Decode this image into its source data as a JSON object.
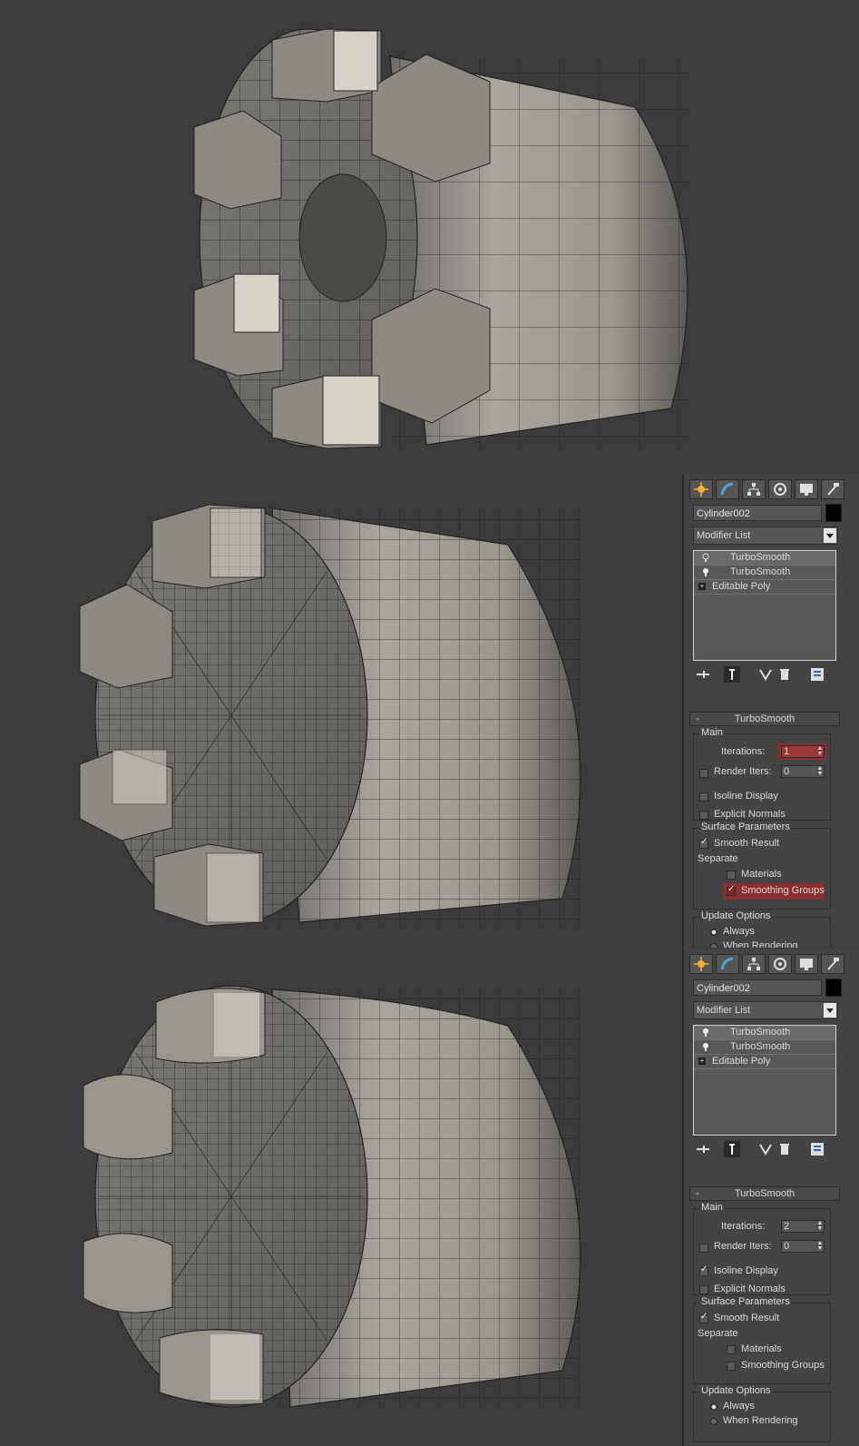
{
  "colors": {
    "viewport_bg": "#3c3c3c",
    "panel_bg": "#444444",
    "mesh_face": "#8c8a84",
    "mesh_highlight": "#d6d2c8",
    "highlight_red": "#8a3030"
  },
  "viewport": {
    "models": [
      {
        "name": "low-poly-cylinder"
      },
      {
        "name": "turbosmooth-iteration-1"
      },
      {
        "name": "turbosmooth-iteration-2-isoline"
      }
    ]
  },
  "panels": [
    {
      "tabs": [
        "create-icon",
        "modify-icon",
        "hierarchy-icon",
        "motion-icon",
        "display-icon",
        "utilities-icon"
      ],
      "object_name": "Cylinder002",
      "modifier_list": "Modifier List",
      "stack": [
        {
          "label": "TurboSmooth",
          "active": true
        },
        {
          "label": "TurboSmooth",
          "active": false
        },
        {
          "label": "Editable Poly"
        }
      ],
      "rollout_title": "TurboSmooth",
      "main_group": "Main",
      "iterations_label": "Iterations:",
      "iterations_value": "1",
      "render_iters_label": "Render Iters:",
      "render_iters_value": "0",
      "isoline_label": "Isoline Display",
      "isoline_checked": false,
      "explicit_label": "Explicit Normals",
      "surface_group": "Surface Parameters",
      "smooth_result_label": "Smooth Result",
      "separate_label": "Separate",
      "materials_label": "Materials",
      "smoothing_groups_label": "Smoothing Groups",
      "smoothing_groups_checked": true,
      "update_group": "Update Options",
      "always_label": "Always",
      "when_rendering_label": "When Rendering"
    },
    {
      "tabs": [
        "create-icon",
        "modify-icon",
        "hierarchy-icon",
        "motion-icon",
        "display-icon",
        "utilities-icon"
      ],
      "object_name": "Cylinder002",
      "modifier_list": "Modifier List",
      "stack": [
        {
          "label": "TurboSmooth",
          "active": true
        },
        {
          "label": "TurboSmooth",
          "active": false
        },
        {
          "label": "Editable Poly"
        }
      ],
      "rollout_title": "TurboSmooth",
      "main_group": "Main",
      "iterations_label": "Iterations:",
      "iterations_value": "2",
      "render_iters_label": "Render Iters:",
      "render_iters_value": "0",
      "isoline_label": "Isoline Display",
      "isoline_checked": true,
      "explicit_label": "Explicit Normals",
      "surface_group": "Surface Parameters",
      "smooth_result_label": "Smooth Result",
      "separate_label": "Separate",
      "materials_label": "Materials",
      "smoothing_groups_label": "Smoothing Groups",
      "smoothing_groups_checked": false,
      "update_group": "Update Options",
      "always_label": "Always",
      "when_rendering_label": "When Rendering"
    }
  ]
}
